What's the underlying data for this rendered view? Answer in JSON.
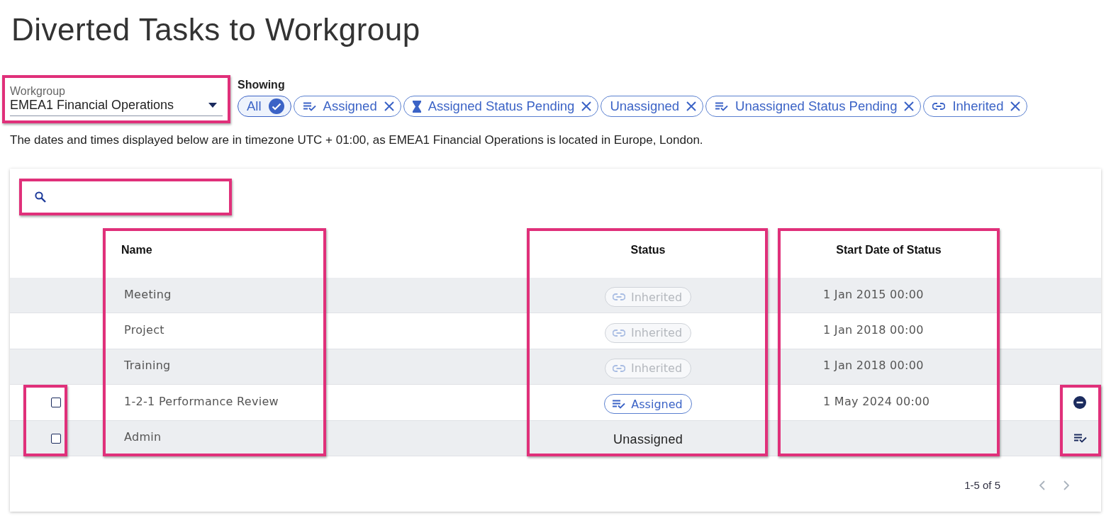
{
  "title": "Diverted Tasks to Workgroup",
  "workgroup": {
    "label": "Workgroup",
    "value": "EMEA1 Financial Operations",
    "highlighted": true
  },
  "filters": {
    "label": "Showing",
    "chips": [
      {
        "label": "All",
        "kind": "all",
        "selected": true
      },
      {
        "label": "Assigned",
        "kind": "assigned",
        "selected": false
      },
      {
        "label": "Assigned Status Pending",
        "kind": "pending",
        "selected": false
      },
      {
        "label": "Unassigned",
        "kind": "unassigned",
        "selected": false
      },
      {
        "label": "Unassigned Status Pending",
        "kind": "assigned",
        "selected": false
      },
      {
        "label": "Inherited",
        "kind": "inherited",
        "selected": false
      }
    ]
  },
  "timezone_note": "The dates and times displayed below are in timezone UTC + 01:00, as EMEA1 Financial Operations is located in Europe, London.",
  "search": {
    "highlighted": true
  },
  "table": {
    "columns": [
      {
        "kind": "select",
        "highlighted": true
      },
      {
        "kind": "name",
        "label": "Name",
        "highlighted": true
      },
      {
        "kind": "status",
        "label": "Status",
        "highlighted": true
      },
      {
        "kind": "date",
        "label": "Start Date of Status",
        "highlighted": true
      },
      {
        "kind": "actions",
        "highlighted": true
      }
    ],
    "rows": [
      {
        "name": "Meeting",
        "status": {
          "label": "Inherited",
          "kind": "inherited",
          "disabled": true
        },
        "start_date": "1 Jan 2015 00:00"
      },
      {
        "name": "Project",
        "status": {
          "label": "Inherited",
          "kind": "inherited",
          "disabled": true
        },
        "start_date": "1 Jan 2018 00:00"
      },
      {
        "name": "Training",
        "status": {
          "label": "Inherited",
          "kind": "inherited",
          "disabled": true
        },
        "start_date": "1 Jan 2018 00:00"
      },
      {
        "name": "1-2-1 Performance Review",
        "checked": false,
        "status": {
          "label": "Assigned",
          "kind": "assigned",
          "disabled": false
        },
        "start_date": "1 May 2024 00:00",
        "action": {
          "kind": "remove"
        }
      },
      {
        "name": "Admin",
        "checked": false,
        "status": {
          "label": "Unassigned",
          "kind": "plain"
        },
        "action": {
          "kind": "assign"
        }
      }
    ]
  },
  "pagination": {
    "range": "1-5 of 5",
    "prev_disabled": true,
    "next_disabled": true
  }
}
